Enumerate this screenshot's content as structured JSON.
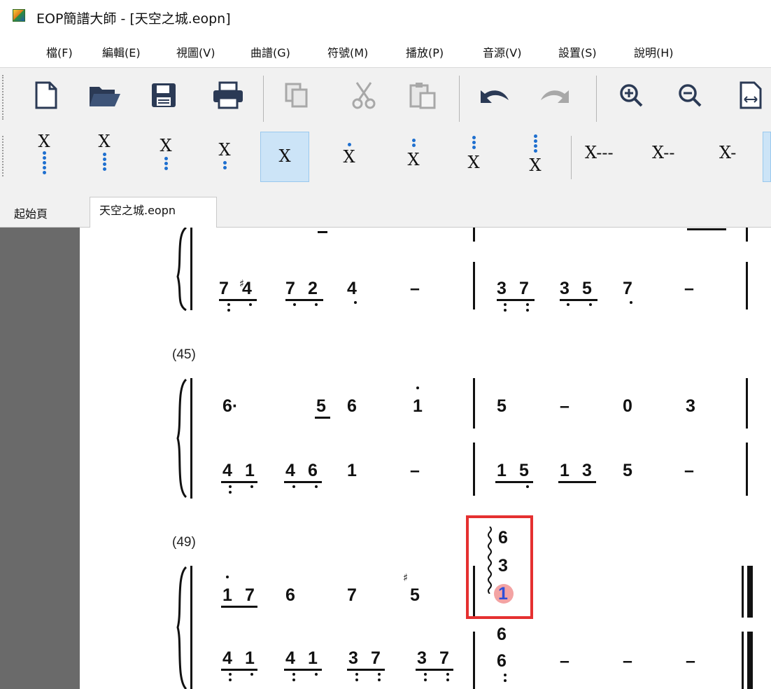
{
  "window": {
    "title": "EOP簡譜大師 - [天空之城.eopn]"
  },
  "menu": [
    "檔(F)",
    "編輯(E)",
    "視圖(V)",
    "曲譜(G)",
    "符號(M)",
    "播放(P)",
    "音源(V)",
    "設置(S)",
    "說明(H)"
  ],
  "toolbar": {
    "buttons": [
      "new-file-icon",
      "open-folder-icon",
      "save-icon",
      "print-icon",
      "copy-icon",
      "cut-icon",
      "paste-icon",
      "undo-icon",
      "redo-icon",
      "zoom-in-icon",
      "zoom-out-icon",
      "page-width-icon"
    ],
    "durations": {
      "symbol": "X",
      "selected_index": 4
    },
    "lengths": [
      "X---",
      "X--",
      "X-"
    ]
  },
  "tabs": [
    "起始頁",
    "天空之城.eopn"
  ],
  "score": {
    "measure_labels": [
      "(45)",
      "(49)"
    ],
    "system1_lower": [
      "7",
      "4",
      "7",
      "2",
      "4",
      "–",
      "3",
      "7",
      "3",
      "5",
      "7",
      "–"
    ],
    "system2_upper": [
      "6·",
      "5",
      "6",
      "1",
      "5",
      "–",
      "0",
      "3"
    ],
    "system2_lower": [
      "4",
      "1",
      "4",
      "6",
      "1",
      "–",
      "1",
      "5",
      "1",
      "3",
      "5",
      "–"
    ],
    "system3_upper": [
      "1",
      "7",
      "6",
      "7",
      "5"
    ],
    "chord": [
      "6",
      "3",
      "1"
    ],
    "system3_lower": [
      "4",
      "1",
      "4",
      "1",
      "3",
      "7",
      "3",
      "7",
      "6",
      "6",
      "–",
      "–",
      "–"
    ],
    "sharp_sign": "♯"
  },
  "colors": {
    "selection": "#cce4f7",
    "highlight_box": "#e53030",
    "note_select": "#2d4fd8",
    "margin": "#6a6a6a"
  }
}
